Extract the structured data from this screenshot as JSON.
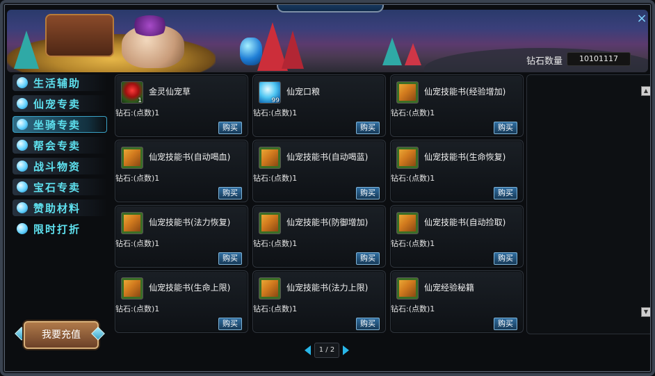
{
  "window": {
    "title": "",
    "close_icon": "×"
  },
  "header": {
    "diamond_label": "钻石数量",
    "diamond_value": "10101117"
  },
  "sidebar": {
    "items": [
      {
        "label": "生活辅助",
        "icon": "swirl-icon"
      },
      {
        "label": "仙宠专卖",
        "icon": "paw-icon"
      },
      {
        "label": "坐骑专卖",
        "icon": "horse-icon"
      },
      {
        "label": "帮会专卖",
        "icon": "flag-icon"
      },
      {
        "label": "战斗物资",
        "icon": "cube-icon"
      },
      {
        "label": "宝石专卖",
        "icon": "gem-icon"
      },
      {
        "label": "赞助材料",
        "icon": "person-icon"
      },
      {
        "label": "限时打折",
        "icon": "megaphone-icon"
      }
    ],
    "active_index": 2,
    "recharge_label": "我要充值"
  },
  "items": [
    {
      "name": "金灵仙宠草",
      "icon": "flower",
      "count": "1",
      "price": "钻石:(点数)1",
      "buy": "购买"
    },
    {
      "name": "仙宠口粮",
      "icon": "drop",
      "count": "99",
      "price": "钻石:(点数)1",
      "buy": "购买"
    },
    {
      "name": "仙宠技能书(经验增加)",
      "icon": "book",
      "count": "",
      "price": "钻石:(点数)1",
      "buy": "购买"
    },
    {
      "name": "仙宠技能书(自动喝血)",
      "icon": "book",
      "count": "",
      "price": "钻石:(点数)1",
      "buy": "购买"
    },
    {
      "name": "仙宠技能书(自动喝蓝)",
      "icon": "book",
      "count": "",
      "price": "钻石:(点数)1",
      "buy": "购买"
    },
    {
      "name": "仙宠技能书(生命恢复)",
      "icon": "book",
      "count": "",
      "price": "钻石:(点数)1",
      "buy": "购买"
    },
    {
      "name": "仙宠技能书(法力恢复)",
      "icon": "book",
      "count": "",
      "price": "钻石:(点数)1",
      "buy": "购买"
    },
    {
      "name": "仙宠技能书(防御增加)",
      "icon": "book",
      "count": "",
      "price": "钻石:(点数)1",
      "buy": "购买"
    },
    {
      "name": "仙宠技能书(自动捡取)",
      "icon": "book",
      "count": "",
      "price": "钻石:(点数)1",
      "buy": "购买"
    },
    {
      "name": "仙宠技能书(生命上限)",
      "icon": "book",
      "count": "",
      "price": "钻石:(点数)1",
      "buy": "购买"
    },
    {
      "name": "仙宠技能书(法力上限)",
      "icon": "book",
      "count": "",
      "price": "钻石:(点数)1",
      "buy": "购买"
    },
    {
      "name": "仙宠经验秘籍",
      "icon": "book",
      "count": "",
      "price": "钻石:(点数)1",
      "buy": "购买"
    }
  ],
  "pagination": {
    "label": "1 / 2",
    "current": 1,
    "total": 2
  },
  "scrollbar": {
    "up": "▲",
    "down": "▼"
  }
}
